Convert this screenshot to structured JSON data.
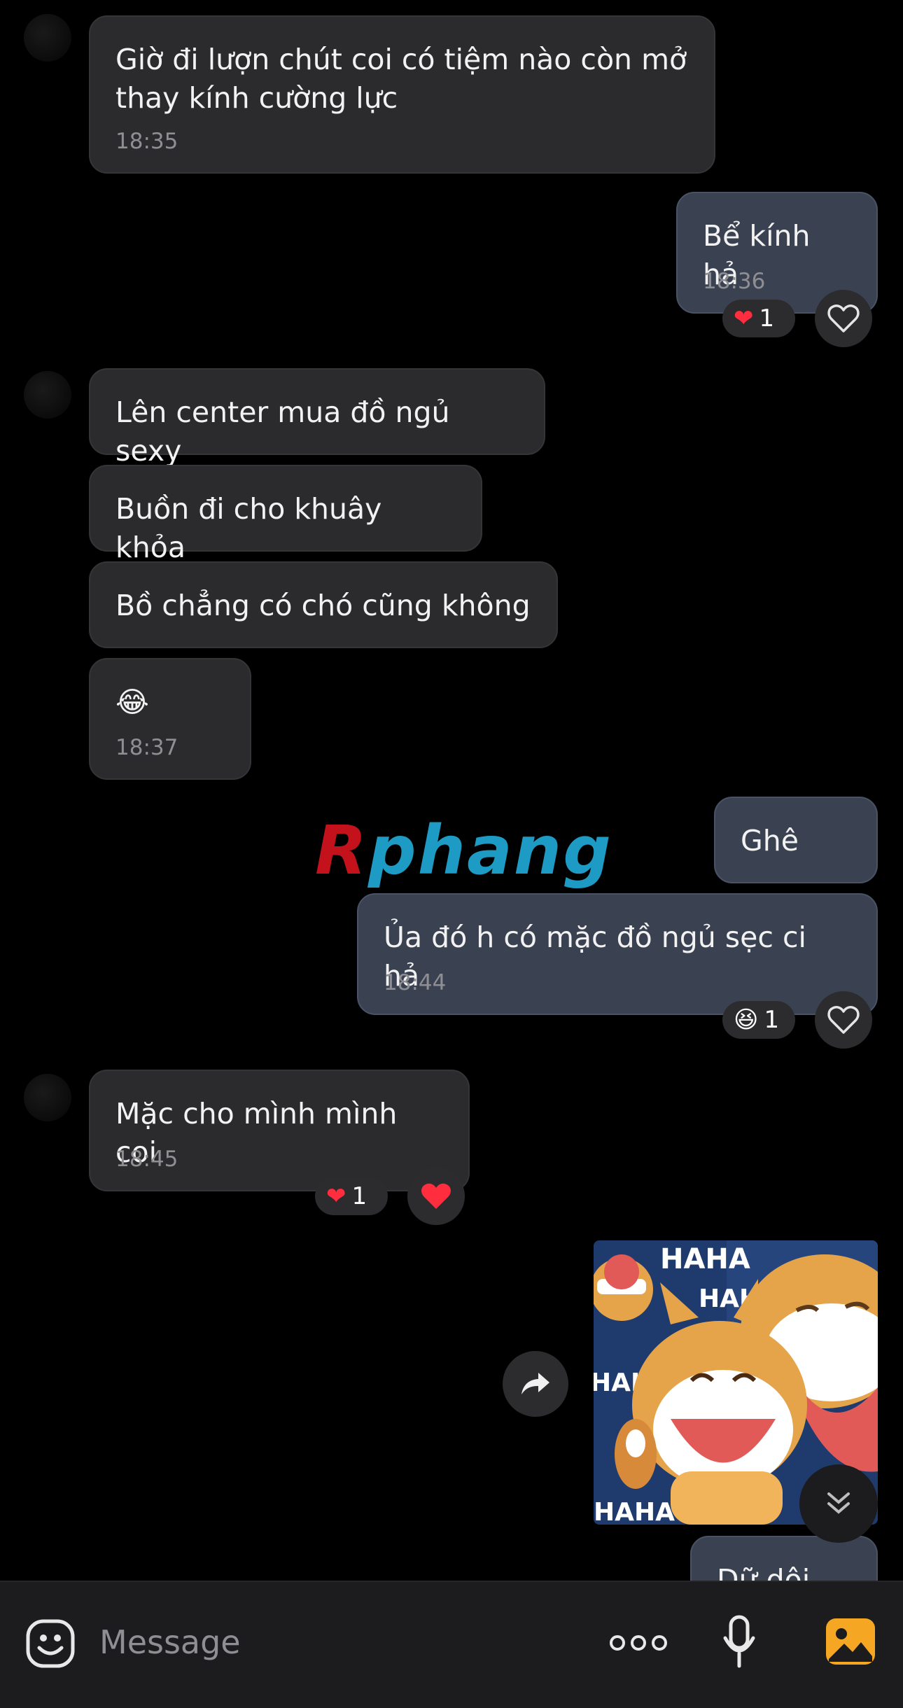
{
  "messages": {
    "m1": {
      "text": "Giờ đi lượn chút coi có tiệm nào còn mở thay kính cường lực",
      "time": "18:35"
    },
    "m2": {
      "text": "Bể kính hả",
      "time": "18:36",
      "reaction_count": "1"
    },
    "m3": {
      "text": "Lên center mua đồ ngủ sexy"
    },
    "m4": {
      "text": "Buồn đi cho khuây khỏa"
    },
    "m5": {
      "text": "Bồ chẳng có chó cũng không"
    },
    "m6": {
      "text": "😂",
      "time": "18:37"
    },
    "m7": {
      "text": "Ghê"
    },
    "m8": {
      "text": "Ủa đó h có mặc đồ ngủ sẹc ci hả",
      "time": "18:44",
      "reaction_count": "1"
    },
    "m9": {
      "text": "Mặc cho mình mình coi",
      "time": "18:45",
      "reaction_count": "1"
    },
    "m11": {
      "text": "Dữ dội he"
    }
  },
  "sticker": {
    "label": "HAHA",
    "icon": "laughing-fox-sticker"
  },
  "watermark": {
    "first": "R",
    "rest": "phang"
  },
  "composer": {
    "placeholder": "Message"
  },
  "icons": {
    "emoji": "sticker-face-icon",
    "more": "more-dots-icon",
    "mic": "microphone-icon",
    "gallery": "gallery-icon",
    "share": "share-arrow-icon",
    "scroll": "scroll-down-icon",
    "like": "heart-outline-icon"
  },
  "colors": {
    "incoming": "#2b2b2d",
    "outgoing": "#3a4252",
    "accent": "#f5a623",
    "heart": "#ff2d3d"
  }
}
